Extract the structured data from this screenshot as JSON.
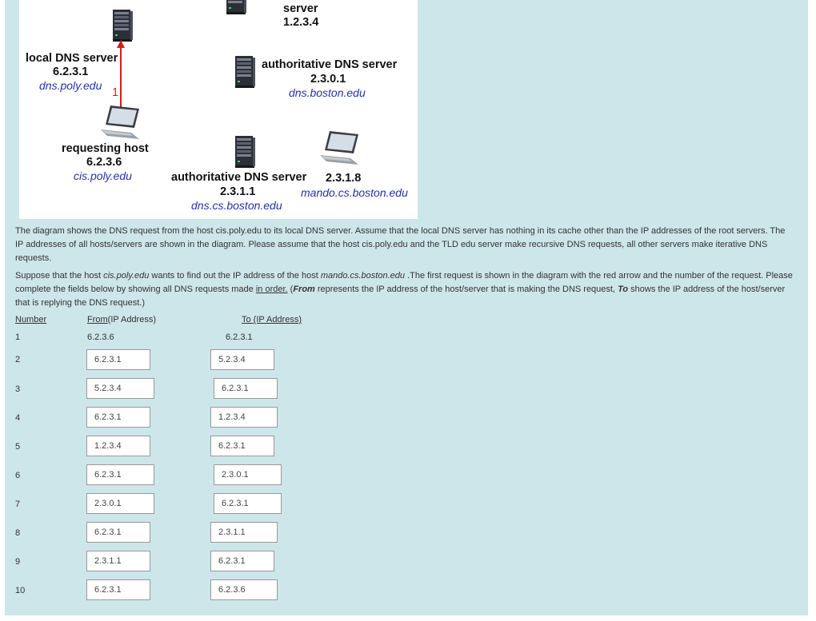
{
  "diagram": {
    "root_label": "server",
    "root_ip": "1.2.3.4",
    "local_label": "local DNS server",
    "local_ip": "6.2.3.1",
    "local_domain": "dns.poly.edu",
    "arrow_number": "1",
    "auth1_label": "authoritative DNS server",
    "auth1_ip": "2.3.0.1",
    "auth1_domain": "dns.boston.edu",
    "req_label": "requesting host",
    "req_ip": "6.2.3.6",
    "req_domain": "cis.poly.edu",
    "auth2_label": "authoritative DNS server",
    "auth2_ip": "2.3.1.1",
    "auth2_domain": "dns.cs.boston.edu",
    "target_ip": "2.3.1.8",
    "target_domain": "mando.cs.boston.edu",
    "arrow_color": "#cc2222"
  },
  "question": {
    "p1": "The diagram shows the DNS request from the host cis.poly.edu to its local DNS server. Assume that the local DNS server has nothing in its cache other than the IP addresses of the root servers. The IP addresses of all hosts/servers are shown in the diagram. Please assume that the host cis.poly.edu and the TLD edu server make recursive DNS requests, all other servers make iterative DNS requests.",
    "p2_a": "Suppose that the host ",
    "p2_host": "cis.poly.edu",
    "p2_b": " wants to find out the IP address of the host ",
    "p2_target": "mando.cs.boston.edu",
    "p2_c": " .The first request is shown in the diagram with the red arrow and the number of the request.  Please complete the fields below by showing all DNS requests made ",
    "p2_order": "in order.",
    "p2_d": " (",
    "p2_from": "From",
    "p2_e": " represents the IP address of the host/server that is making the DNS request, ",
    "p2_to": "To",
    "p2_f": " shows the IP address of the host/server that is replying the DNS request.)"
  },
  "table": {
    "col_number": "Number",
    "col_from_a": "From",
    "col_from_b": " (IP Address)",
    "col_to": "To (IP Address)",
    "rows": [
      {
        "number": "1",
        "from": "6.2.3.6",
        "to": "6.2.3.1"
      },
      {
        "number": "2",
        "from": "6.2.3.1",
        "to": "5.2.3.4"
      },
      {
        "number": "3",
        "from": "5.2.3.4",
        "to": "6.2.3.1"
      },
      {
        "number": "4",
        "from": "6.2.3.1",
        "to": "1.2.3.4"
      },
      {
        "number": "5",
        "from": "1.2.3.4",
        "to": "6.2.3.1"
      },
      {
        "number": "6",
        "from": "6.2.3.1",
        "to": "2.3.0.1"
      },
      {
        "number": "7",
        "from": "2.3.0.1",
        "to": "6.2.3.1"
      },
      {
        "number": "8",
        "from": "6.2.3.1",
        "to": "2.3.1.1"
      },
      {
        "number": "9",
        "from": "2.3.1.1",
        "to": "6.2.3.1"
      },
      {
        "number": "10",
        "from": "6.2.3.1",
        "to": "6.2.3.6"
      }
    ]
  }
}
